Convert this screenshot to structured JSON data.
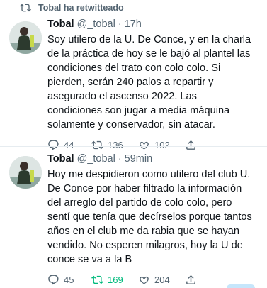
{
  "retweet_header": {
    "text": "Tobal ha retwitteado"
  },
  "tweets": [
    {
      "name": "Tobal",
      "handle": "@_tobal",
      "separator": "·",
      "time": "17h",
      "text": "Soy utilero de la U. De Conce, y en la charla\nde la práctica de hoy se le bajó al plantel las\ncondiciones del trato con colo colo. Si\npierden, serán 240 palos a repartir y\nasegurado el ascenso 2022. Las\ncondiciones son jugar a media máquina\nsolamente y conservador, sin atacar.",
      "replies": "44",
      "retweets": "136",
      "likes": "102",
      "retweeted": false
    },
    {
      "name": "Tobal",
      "handle": "@_tobal",
      "separator": "·",
      "time": "59min",
      "text": "Hoy me despidieron como utilero del club U.\nDe Conce por haber filtrado la información\ndel arreglo del partido de colo colo, pero\nsentí que tenía que decírselos porque tantos\naños en el club me da rabia que se hayan\nvendido. No esperen milagros, hoy la U de\nconce se va a la B",
      "replies": "45",
      "retweets": "169",
      "likes": "204",
      "retweeted": true
    }
  ],
  "icons": {
    "retweet": "retweet-icon",
    "reply": "reply-icon",
    "like": "heart-icon",
    "share": "share-icon"
  },
  "colors": {
    "text": "#0f1419",
    "muted": "#536471",
    "retweet_active": "#00ba7c"
  }
}
